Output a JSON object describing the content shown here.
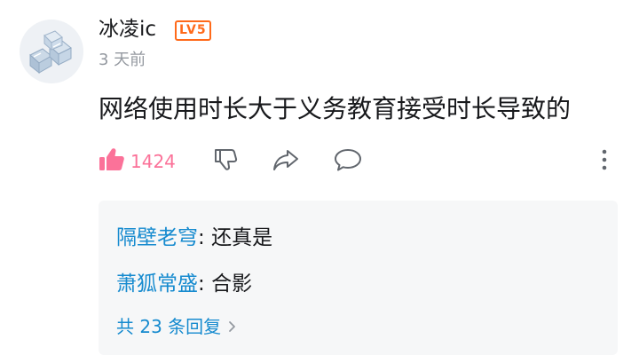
{
  "comment": {
    "username": "冰凌ic",
    "level_badge": "LV5",
    "timestamp": "3 天前",
    "text": "网络使用时长大于义务教育接受时长导致的",
    "like_count": "1424"
  },
  "replies": [
    {
      "name": "隔壁老穹",
      "separator": ": ",
      "text": "还真是"
    },
    {
      "name": "萧狐常盛",
      "separator": ": ",
      "text": "合影"
    }
  ],
  "view_replies_label": "共 23 条回复",
  "colors": {
    "like_accent": "#fb7299",
    "link_blue": "#178bcf",
    "level_orange": "#ff6a1a",
    "reply_bg": "#f6f7f8"
  },
  "icons": {
    "like": "thumbs-up-filled-icon",
    "dislike": "thumbs-down-icon",
    "share": "share-arrow-icon",
    "reply": "speech-bubble-icon",
    "more": "vertical-dots-icon",
    "chevron": "chevron-right-icon"
  }
}
